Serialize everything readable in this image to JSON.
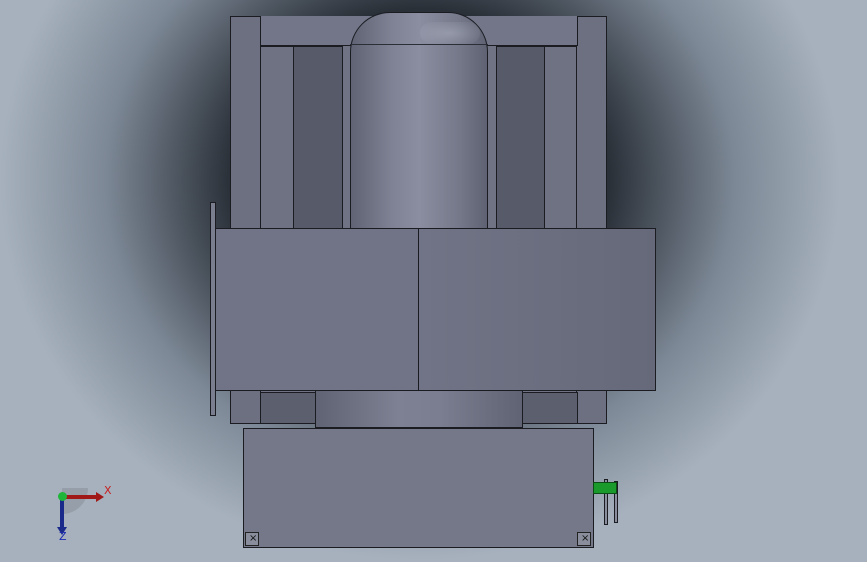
{
  "viewport": {
    "background_top": "#0c0f14",
    "background_edge": "#a6b1bd",
    "part_color": "#707486",
    "shaft_color": "#1a9a2a"
  },
  "triad": {
    "x_label": "X",
    "z_label": "Z",
    "x_color": "#a01818",
    "z_color": "#1a2a8a",
    "origin_color": "#1fb43a"
  },
  "screws": {
    "left_mark": "×",
    "right_mark": "×"
  }
}
